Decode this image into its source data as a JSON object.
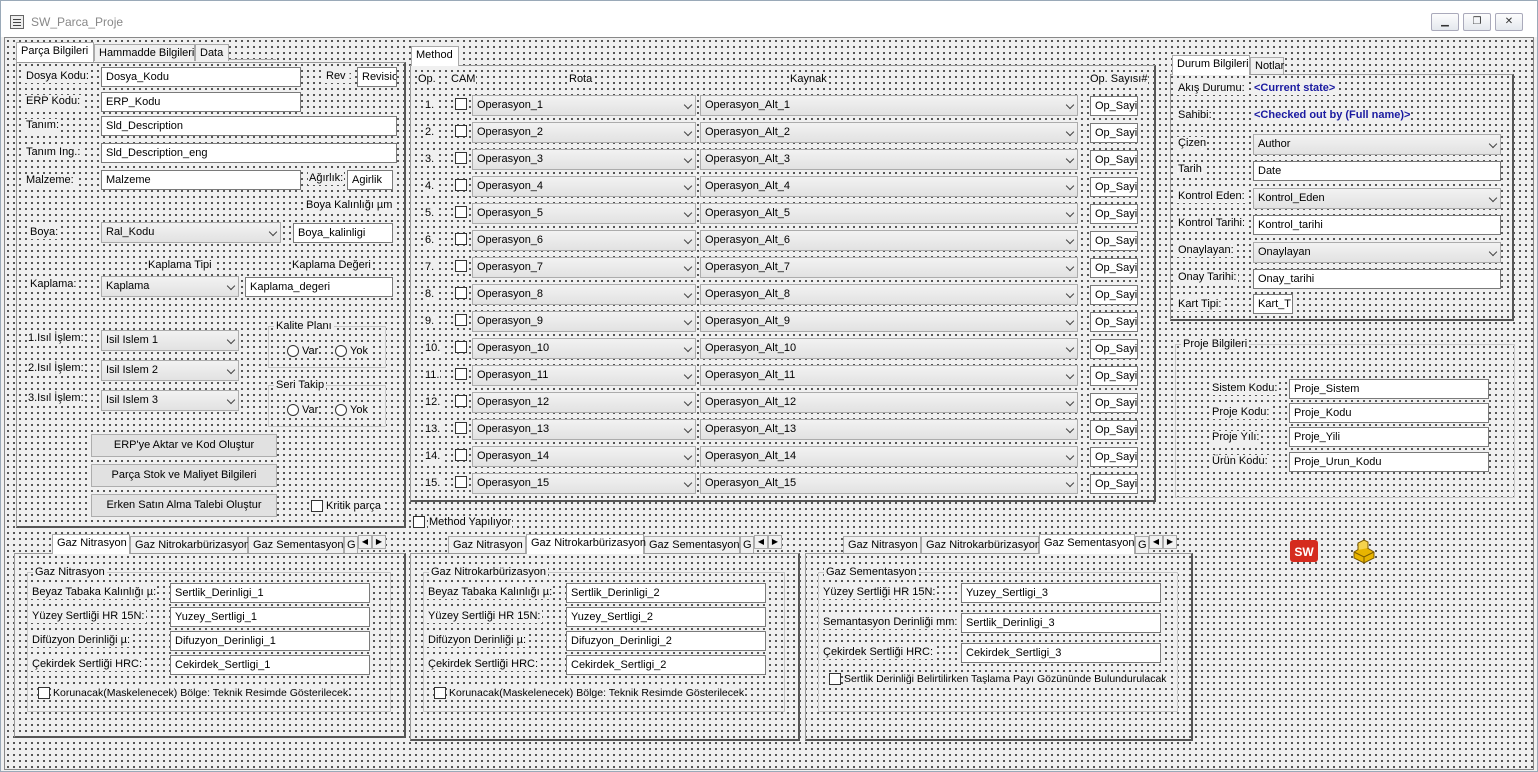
{
  "window": {
    "title": "SW_Parca_Proje"
  },
  "left_tabs": {
    "t1": "Parça Bilgileri",
    "t2": "Hammadde Bilgileri",
    "t3": "Data"
  },
  "parca": {
    "dosya_kodu_lbl": "Dosya Kodu:",
    "dosya_kodu": "Dosya_Kodu",
    "rev_lbl": "Rev :",
    "rev": "Revisio",
    "erp_kodu_lbl": "ERP Kodu:",
    "erp_kodu": "ERP_Kodu",
    "tanim_lbl": "Tanım:",
    "tanim": "Sld_Description",
    "tanim_ing_lbl": "Tanım Ing.:",
    "tanim_ing": "Sld_Description_eng",
    "malzeme_lbl": "Malzeme:",
    "malzeme": "Malzeme",
    "agirlik_lbl": "Ağırlık:",
    "agirlik": "Agirlik",
    "boya_kalinlik_lbl": "Boya Kalınlığı µm",
    "boya_lbl": "Boya:",
    "boya": "Ral_Kodu",
    "boya_kalinligi": "Boya_kalinligi",
    "kaplama_tipi_lbl": "Kaplama Tipi",
    "kaplama_degeri_lbl": "Kaplama Değeri",
    "kaplama_lbl": "Kaplama:",
    "kaplama": "Kaplama",
    "kaplama_degeri": "Kaplama_degeri",
    "isil1_lbl": "1.Isıl İşlem:",
    "isil1": "Isil Islem 1",
    "isil2_lbl": "2.Isıl İşlem:",
    "isil2": "Isil Islem 2",
    "isil3_lbl": "3.Isıl İşlem:",
    "isil3": "Isil Islem 3",
    "kalite_plani": "Kalite Planı",
    "seri_takip": "Seri Takip",
    "var": "Var",
    "yok": "Yok",
    "btn_erp": "ERP'ye Aktar ve Kod Oluştur",
    "btn_stok": "Parça Stok ve Maliyet Bilgileri",
    "btn_erken": "Erken Satın Alma Talebi Oluştur",
    "kritik": "Kritik parça"
  },
  "method": {
    "tab": "Method",
    "headers": {
      "op": "Op.",
      "cam": "CAM",
      "rota": "Rota",
      "kaynak": "Kaynak",
      "sayisi": "Op. Sayısı#"
    },
    "rows": [
      {
        "no": "1.",
        "rota": "Operasyon_1",
        "kaynak": "Operasyon_Alt_1",
        "sayi": "Op_Sayi"
      },
      {
        "no": "2.",
        "rota": "Operasyon_2",
        "kaynak": "Operasyon_Alt_2",
        "sayi": "Op_Sayi"
      },
      {
        "no": "3.",
        "rota": "Operasyon_3",
        "kaynak": "Operasyon_Alt_3",
        "sayi": "Op_Sayi"
      },
      {
        "no": "4.",
        "rota": "Operasyon_4",
        "kaynak": "Operasyon_Alt_4",
        "sayi": "Op_Sayi"
      },
      {
        "no": "5.",
        "rota": "Operasyon_5",
        "kaynak": "Operasyon_Alt_5",
        "sayi": "Op_Sayi"
      },
      {
        "no": "6.",
        "rota": "Operasyon_6",
        "kaynak": "Operasyon_Alt_6",
        "sayi": "Op_Sayi"
      },
      {
        "no": "7.",
        "rota": "Operasyon_7",
        "kaynak": "Operasyon_Alt_7",
        "sayi": "Op_Sayi"
      },
      {
        "no": "8.",
        "rota": "Operasyon_8",
        "kaynak": "Operasyon_Alt_8",
        "sayi": "Op_Sayi"
      },
      {
        "no": "9.",
        "rota": "Operasyon_9",
        "kaynak": "Operasyon_Alt_9",
        "sayi": "Op_Sayi"
      },
      {
        "no": "10.",
        "rota": "Operasyon_10",
        "kaynak": "Operasyon_Alt_10",
        "sayi": "Op_Sayi"
      },
      {
        "no": "11.",
        "rota": "Operasyon_11",
        "kaynak": "Operasyon_Alt_11",
        "sayi": "Op_Sayi"
      },
      {
        "no": "12.",
        "rota": "Operasyon_12",
        "kaynak": "Operasyon_Alt_12",
        "sayi": "Op_Sayi"
      },
      {
        "no": "13.",
        "rota": "Operasyon_13",
        "kaynak": "Operasyon_Alt_13",
        "sayi": "Op_Sayi"
      },
      {
        "no": "14.",
        "rota": "Operasyon_14",
        "kaynak": "Operasyon_Alt_14",
        "sayi": "Op_Sayi"
      },
      {
        "no": "15.",
        "rota": "Operasyon_15",
        "kaynak": "Operasyon_Alt_15",
        "sayi": "Op_Sayi"
      }
    ],
    "yapiliyor": "Method Yapılıyor"
  },
  "durum": {
    "tab1": "Durum Bilgileri",
    "tab2": "Notlar",
    "akis_lbl": "Akış Durumu:",
    "akis": "<Current state>",
    "sahibi_lbl": "Sahibi:",
    "sahibi": "<Checked out by (Full name)>",
    "cizen_lbl": "Çizen",
    "cizen": "Author",
    "tarih_lbl": "Tarih",
    "tarih": "Date",
    "kontrol_eden_lbl": "Kontrol Eden:",
    "kontrol_eden": "Kontrol_Eden",
    "kontrol_tarihi_lbl": "Kontrol Tarihi:",
    "kontrol_tarihi": "Kontrol_tarihi",
    "onaylayan_lbl": "Onaylayan:",
    "onaylayan": "Onaylayan",
    "onay_tarihi_lbl": "Onay Tarihi:",
    "onay_tarihi": "Onay_tarihi",
    "kart_tipi_lbl": "Kart Tipi:",
    "kart_tipi": "Kart_T"
  },
  "proje": {
    "title": "Proje Bilgileri",
    "sistem_lbl": "Sistem Kodu:",
    "sistem": "Proje_Sistem",
    "kodu_lbl": "Proje Kodu:",
    "kodu": "Proje_Kodu",
    "yili_lbl": "Proje Yılı:",
    "yili": "Proje_Yili",
    "urun_lbl": "Ürün Kodu:",
    "urun": "Proje_Urun_Kodu"
  },
  "bottom_tabs": {
    "nitrasyon": "Gaz Nitrasyon",
    "nitrokarb": "Gaz Nitrokarbürizasyon",
    "sementasyon": "Gaz Sementasyon",
    "more": "G"
  },
  "gaz1": {
    "group": "Gaz Nitrasyon",
    "l1": "Beyaz Tabaka Kalınlığı µ:",
    "v1": "Sertlik_Derinligi_1",
    "l2": "Yüzey Sertliği HR 15N:",
    "v2": "Yuzey_Sertligi_1",
    "l3": "Difüzyon Derinliği µ:",
    "v3": "Difuzyon_Derinligi_1",
    "l4": "Çekirdek Sertliği HRC:",
    "v4": "Cekirdek_Sertligi_1",
    "chk": "Korunacak(Maskelenecek) Bölge: Teknik Resimde Gösterilecek"
  },
  "gaz2": {
    "group": "Gaz Nitrokarbürizasyon",
    "l1": "Beyaz Tabaka Kalınlığı µ:",
    "v1": "Sertlik_Derinligi_2",
    "l2": "Yüzey Sertliği HR 15N:",
    "v2": "Yuzey_Sertligi_2",
    "l3": "Difüzyon Derinliği µ:",
    "v3": "Difuzyon_Derinligi_2",
    "l4": "Çekirdek Sertliği HRC:",
    "v4": "Cekirdek_Sertligi_2",
    "chk": "Korunacak(Maskelenecek) Bölge: Teknik Resimde Gösterilecek"
  },
  "gaz3": {
    "group": "Gaz Sementasyon",
    "l1": "Yüzey Sertliği HR 15N:",
    "v1": "Yuzey_Sertligi_3",
    "l2": "Semantasyon Derinliği mm:",
    "v2": "Sertlik_Derinligi_3",
    "l3": "Çekirdek Sertliği HRC:",
    "v3": "Cekirdek_Sertligi_3",
    "chk": "Sertlik Derinliği Belirtilirken Taşlama Payı Gözününde Bulundurulacak"
  },
  "icons": {
    "sw": "SW",
    "sw_color": "#d52b1e",
    "part_color": "#e8b400"
  }
}
